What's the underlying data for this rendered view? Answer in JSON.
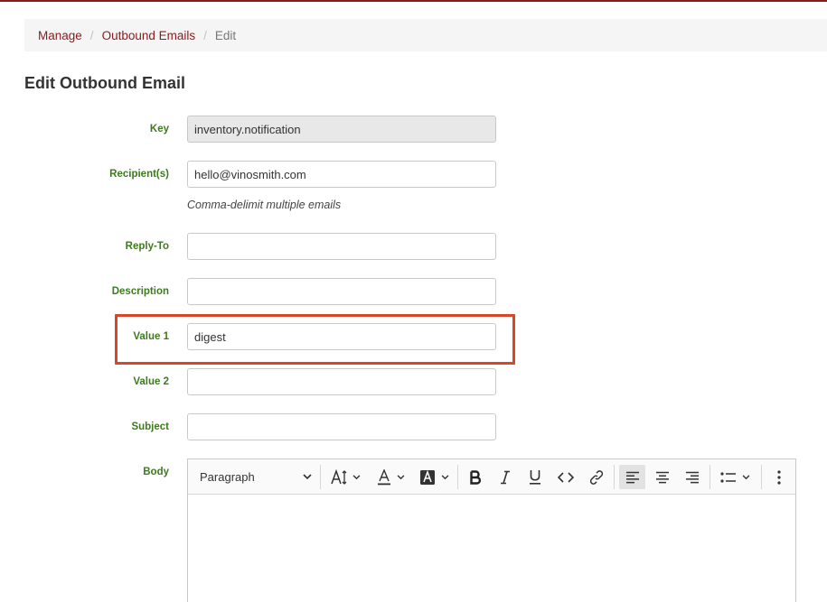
{
  "breadcrumb": {
    "items": [
      "Manage",
      "Outbound Emails"
    ],
    "current": "Edit"
  },
  "page_title": "Edit Outbound Email",
  "form": {
    "key": {
      "label": "Key",
      "value": "inventory.notification"
    },
    "recipients": {
      "label": "Recipient(s)",
      "value": "hello@vinosmith.com",
      "help": "Comma-delimit multiple emails"
    },
    "reply_to": {
      "label": "Reply-To",
      "value": ""
    },
    "description": {
      "label": "Description",
      "value": ""
    },
    "value1": {
      "label": "Value 1",
      "value": "digest"
    },
    "value2": {
      "label": "Value 2",
      "value": ""
    },
    "subject": {
      "label": "Subject",
      "value": ""
    },
    "body": {
      "label": "Body"
    }
  },
  "editor": {
    "block_format": "Paragraph"
  },
  "colors": {
    "accent": "#8b1a1a",
    "label_green": "#3d7a1e",
    "highlight_box": "#d9472b"
  }
}
